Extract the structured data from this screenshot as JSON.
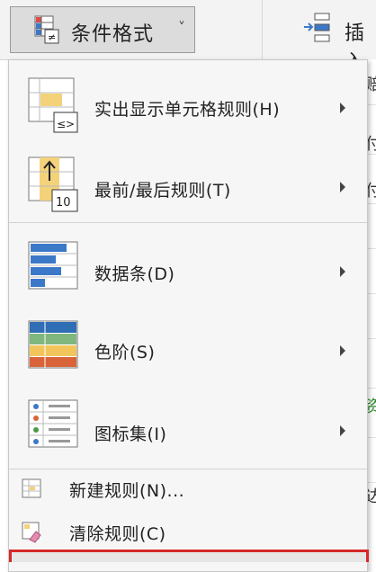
{
  "ribbon": {
    "conditional_formatting_label": "条件格式",
    "conditional_formatting_icon": "conditional-formatting-icon",
    "chevron_glyph": "˅",
    "insert_label": "插入",
    "insert_icon": "insert-rows-icon"
  },
  "sheet_edge": {
    "glyphs": [
      "赔",
      "付",
      "付",
      "资",
      "达"
    ]
  },
  "menu": {
    "items": [
      {
        "label": "实出显示单元格规则(H)",
        "icon": "highlight-cells-rules-icon",
        "icon_text": "≤>"
      },
      {
        "label": "最前/最后规则(T)",
        "icon": "top-bottom-rules-icon",
        "icon_text": "10"
      },
      {
        "label": "数据条(D)",
        "icon": "data-bars-icon"
      },
      {
        "label": "色阶(S)",
        "icon": "color-scales-icon"
      },
      {
        "label": "图标集(I)",
        "icon": "icon-sets-icon"
      }
    ],
    "small_items": [
      {
        "label": "新建规则(N)...",
        "icon": "new-rule-icon"
      },
      {
        "label": "清除规则(C)",
        "icon": "clear-rules-icon"
      }
    ]
  },
  "colors": {
    "accent_blue": "#3c78c8",
    "highlight_yellow": "#f3d27a",
    "highlight_border": "#d62828"
  }
}
